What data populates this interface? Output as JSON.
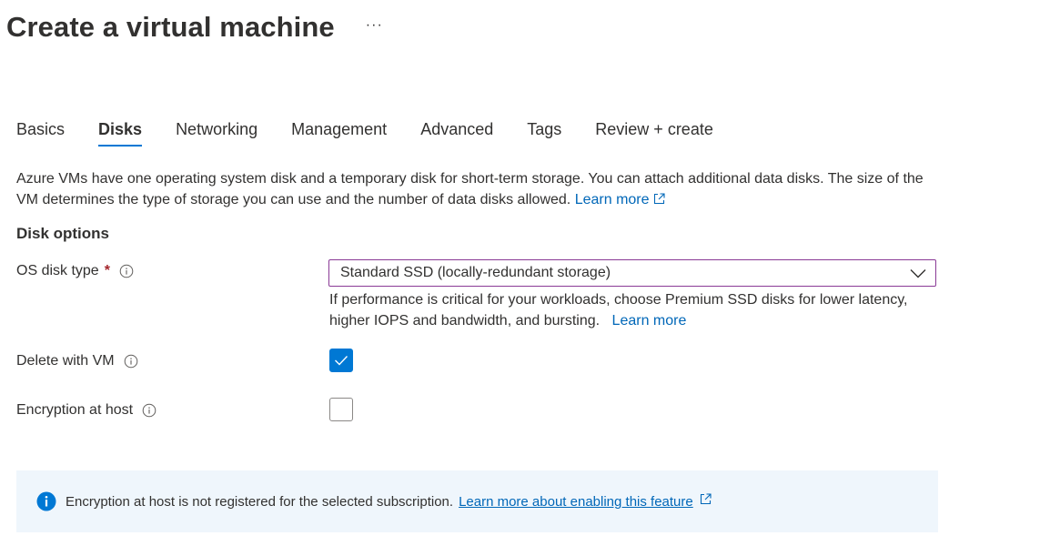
{
  "header": {
    "title": "Create a virtual machine",
    "more_label": "···"
  },
  "tabs": [
    {
      "label": "Basics",
      "active": false
    },
    {
      "label": "Disks",
      "active": true
    },
    {
      "label": "Networking",
      "active": false
    },
    {
      "label": "Management",
      "active": false
    },
    {
      "label": "Advanced",
      "active": false
    },
    {
      "label": "Tags",
      "active": false
    },
    {
      "label": "Review + create",
      "active": false
    }
  ],
  "intro": {
    "text": "Azure VMs have one operating system disk and a temporary disk for short-term storage. You can attach additional data disks. The size of the VM determines the type of storage you can use and the number of data disks allowed.",
    "link": "Learn more"
  },
  "disk_options": {
    "title": "Disk options",
    "os_disk_type": {
      "label": "OS disk type",
      "required_mark": "*",
      "value": "Standard SSD (locally-redundant storage)",
      "hint": "If performance is critical for your workloads, choose Premium SSD disks for lower latency, higher IOPS and bandwidth, and bursting.",
      "hint_link": "Learn more"
    },
    "delete_with_vm": {
      "label": "Delete with VM",
      "checked": true
    },
    "encryption_at_host": {
      "label": "Encryption at host",
      "checked": false
    }
  },
  "banner": {
    "text": "Encryption at host is not registered for the selected subscription.",
    "link": "Learn more about enabling this feature"
  },
  "colors": {
    "accent": "#0078d4",
    "link": "#0067b8",
    "banner_bg": "#eff6fc",
    "required": "#a4262c",
    "select_border": "#8a3a96"
  },
  "icons": {
    "info": "info-circle-icon",
    "external": "external-link-icon",
    "chevron": "chevron-down-icon",
    "check": "checkmark-icon",
    "banner_info": "info-filled-icon"
  }
}
